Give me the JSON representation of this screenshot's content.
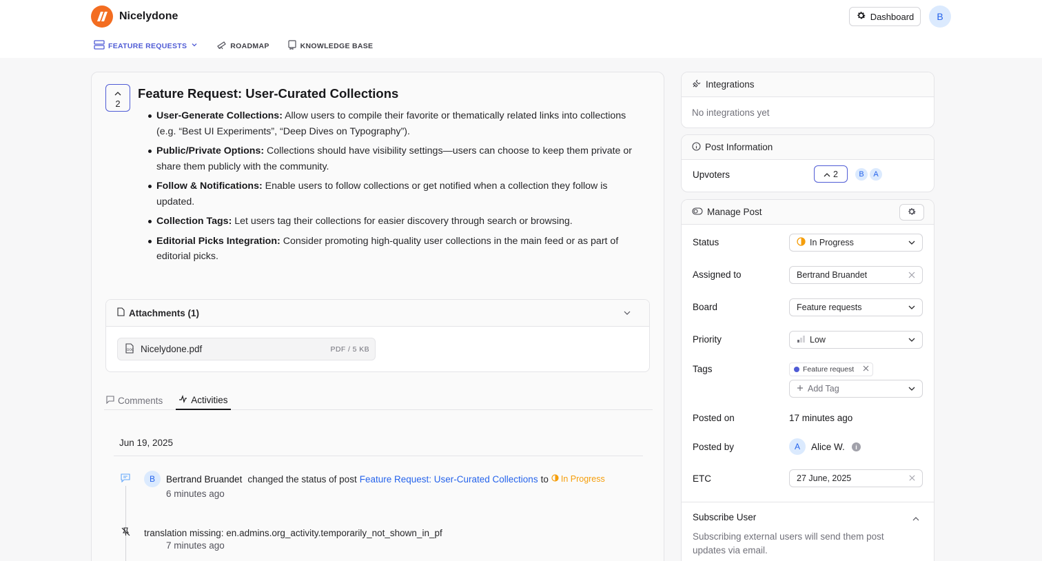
{
  "header": {
    "brand_name": "Nicelydone",
    "dashboard_label": "Dashboard",
    "user_initial": "B"
  },
  "nav": {
    "items": [
      {
        "label": "FEATURE REQUESTS",
        "icon": "list-icon",
        "active": true
      },
      {
        "label": "ROADMAP",
        "icon": "telescope-icon",
        "active": false
      },
      {
        "label": "KNOWLEDGE BASE",
        "icon": "book-icon",
        "active": false
      }
    ]
  },
  "post": {
    "vote_count": "2",
    "title": "Feature Request: User-Curated Collections",
    "bullets": [
      {
        "bold": "User-Generate Collections:",
        "text": " Allow users to compile their favorite or thematically related links into collections (e.g. “Best UI Experiments”, “Deep Dives on Typography”)."
      },
      {
        "bold": "Public/Private Options:",
        "text": " Collections should have visibility settings—users can choose to keep them private or share them publicly with the community."
      },
      {
        "bold": "Follow & Notifications:",
        "text": " Enable users to follow collections or get notified when a collection they follow is updated."
      },
      {
        "bold": "Collection Tags:",
        "text": " Let users tag their collections for easier discovery through search or browsing."
      },
      {
        "bold": "Editorial Picks Integration:",
        "text": " Consider promoting high-quality user collections in the main feed or as part of editorial picks."
      }
    ]
  },
  "attachments": {
    "title": "Attachments (1)",
    "file_name": "Nicelydone.pdf",
    "file_meta": "PDF / 5 KB"
  },
  "tabs": {
    "comments": "Comments",
    "activities": "Activities"
  },
  "activity": {
    "date": "Jun 19, 2025",
    "items": [
      {
        "actor_initial": "B",
        "actor": "Bertrand Bruandet",
        "text": "changed the status of post",
        "link": "Feature Request: User-Curated Collections",
        "to": "to",
        "status": "In Progress",
        "time": "6 minutes ago"
      },
      {
        "text": "translation missing: en.admins.org_activity.temporarily_not_shown_in_pf",
        "time": "7 minutes ago"
      }
    ]
  },
  "integrations": {
    "title": "Integrations",
    "empty": "No integrations yet"
  },
  "post_info": {
    "title": "Post Information",
    "upvoters_label": "Upvoters",
    "upvote_count": "2",
    "upvoter_initials": [
      "B",
      "A"
    ]
  },
  "manage": {
    "title": "Manage Post",
    "status_label": "Status",
    "status_value": "In Progress",
    "assigned_label": "Assigned to",
    "assigned_value": "Bertrand Bruandet",
    "board_label": "Board",
    "board_value": "Feature requests",
    "priority_label": "Priority",
    "priority_value": "Low",
    "tags_label": "Tags",
    "tag_value": "Feature request",
    "add_tag": "Add Tag",
    "posted_on_label": "Posted on",
    "posted_on_value": "17 minutes ago",
    "posted_by_label": "Posted by",
    "posted_by_initial": "A",
    "posted_by_value": "Alice W.",
    "etc_label": "ETC",
    "etc_value": "27 June, 2025",
    "subscribe_title": "Subscribe User",
    "subscribe_desc": "Subscribing external users will send them post updates via email."
  },
  "colors": {
    "accent": "#4f5bd5",
    "brand": "#f36d21",
    "status_in_progress": "#f59e0b",
    "link": "#2563eb"
  }
}
